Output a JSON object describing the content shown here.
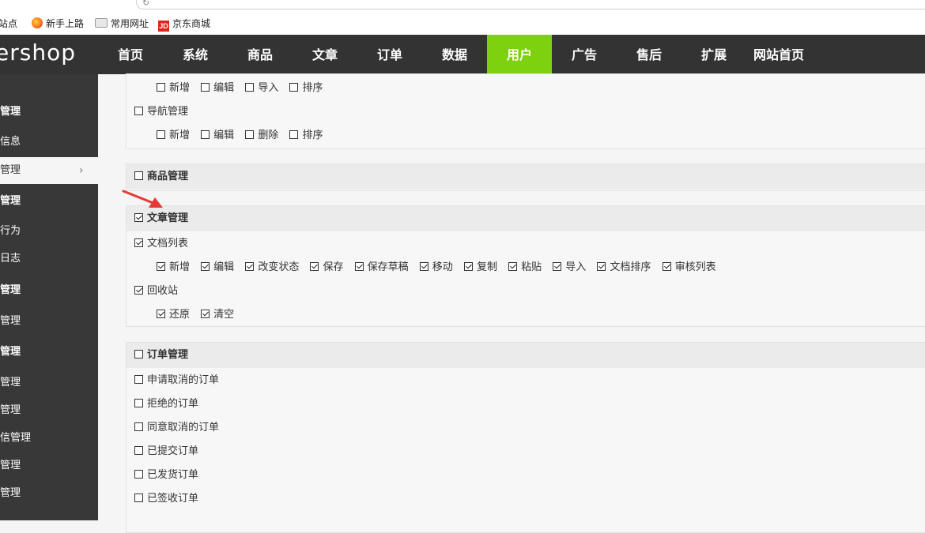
{
  "bookmarks": [
    {
      "label": "站点",
      "icon": "none"
    },
    {
      "label": "新手上路",
      "icon": "firefox-icon"
    },
    {
      "label": "常用网址",
      "icon": "folder-icon"
    },
    {
      "label": "京东商城",
      "icon": "jd-icon",
      "icon_text": "JD"
    }
  ],
  "header": {
    "logo": "ershop",
    "nav": [
      "首页",
      "系统",
      "商品",
      "文章",
      "订单",
      "数据",
      "用户",
      "广告",
      "售后",
      "扩展",
      "网站首页"
    ],
    "active_nav": "用户",
    "accent": "#7ed10e"
  },
  "sidebar": {
    "items": [
      {
        "label": "管理",
        "type": "group"
      },
      {
        "label": "信息",
        "type": "item"
      },
      {
        "label": "管理",
        "type": "item",
        "active": true
      },
      {
        "label": "管理",
        "type": "group"
      },
      {
        "label": "行为",
        "type": "item"
      },
      {
        "label": "日志",
        "type": "item"
      },
      {
        "label": "管理",
        "type": "group"
      },
      {
        "label": "管理",
        "type": "item"
      },
      {
        "label": "管理",
        "type": "group"
      },
      {
        "label": "管理",
        "type": "item"
      },
      {
        "label": "管理",
        "type": "item"
      },
      {
        "label": "信管理",
        "type": "item"
      },
      {
        "label": "管理",
        "type": "item"
      },
      {
        "label": "管理",
        "type": "item"
      }
    ]
  },
  "permissions": {
    "top_actions": [
      {
        "label": "新增",
        "checked": false
      },
      {
        "label": "编辑",
        "checked": false
      },
      {
        "label": "导入",
        "checked": false
      },
      {
        "label": "排序",
        "checked": false
      }
    ],
    "nav_manage": {
      "label": "导航管理",
      "checked": false
    },
    "nav_actions": [
      {
        "label": "新增",
        "checked": false
      },
      {
        "label": "编辑",
        "checked": false
      },
      {
        "label": "删除",
        "checked": false
      },
      {
        "label": "排序",
        "checked": false
      }
    ],
    "goods": {
      "label": "商品管理",
      "checked": false
    },
    "article": {
      "label": "文章管理",
      "checked": true
    },
    "doc_list": {
      "label": "文档列表",
      "checked": true
    },
    "doc_actions": [
      {
        "label": "新增",
        "checked": true
      },
      {
        "label": "编辑",
        "checked": true
      },
      {
        "label": "改变状态",
        "checked": true
      },
      {
        "label": "保存",
        "checked": true
      },
      {
        "label": "保存草稿",
        "checked": true
      },
      {
        "label": "移动",
        "checked": true
      },
      {
        "label": "复制",
        "checked": true
      },
      {
        "label": "粘贴",
        "checked": true
      },
      {
        "label": "导入",
        "checked": true
      },
      {
        "label": "文档排序",
        "checked": true
      },
      {
        "label": "审核列表",
        "checked": true
      }
    ],
    "recycle": {
      "label": "回收站",
      "checked": true
    },
    "recycle_actions": [
      {
        "label": "还原",
        "checked": true
      },
      {
        "label": "清空",
        "checked": true
      }
    ],
    "order": {
      "label": "订单管理",
      "checked": false
    },
    "order_items": [
      {
        "label": "申请取消的订单",
        "checked": false
      },
      {
        "label": "拒绝的订单",
        "checked": false
      },
      {
        "label": "同意取消的订单",
        "checked": false
      },
      {
        "label": "已提交订单",
        "checked": false
      },
      {
        "label": "已发货订单",
        "checked": false
      },
      {
        "label": "已签收订单",
        "checked": false
      }
    ]
  },
  "annotation": {
    "icon": "red-arrow-icon",
    "color": "#e53935"
  }
}
